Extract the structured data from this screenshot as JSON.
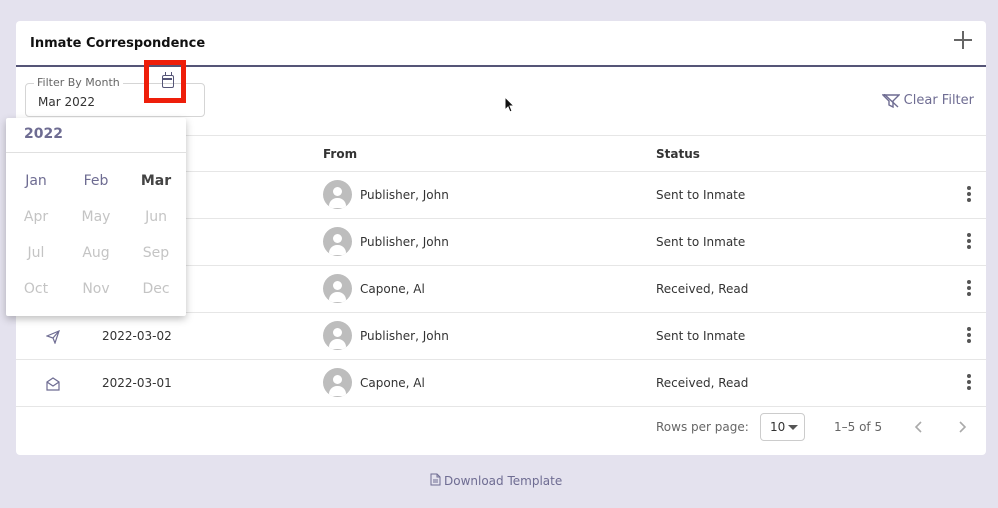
{
  "card": {
    "title": "Inmate Correspondence",
    "add_icon": "plus-icon"
  },
  "filter": {
    "label": "Filter By Month",
    "value": "Mar 2022",
    "calendar_icon": "calendar-icon"
  },
  "clear_filter": {
    "label": "Clear Filter",
    "icon": "filter-off-icon"
  },
  "table": {
    "headers": {
      "from": "From",
      "status": "Status"
    },
    "rows": [
      {
        "icon": "send-icon",
        "date": "",
        "from": "Publisher, John",
        "status": "Sent to Inmate"
      },
      {
        "icon": "send-icon",
        "date": "",
        "from": "Publisher, John",
        "status": "Sent to Inmate"
      },
      {
        "icon": "mail-open-icon",
        "date": "",
        "from": "Capone, Al",
        "status": "Received, Read"
      },
      {
        "icon": "send-icon",
        "date": "2022-03-02",
        "from": "Publisher, John",
        "status": "Sent to Inmate"
      },
      {
        "icon": "mail-open-icon",
        "date": "2022-03-01",
        "from": "Capone, Al",
        "status": "Received, Read"
      }
    ]
  },
  "pagination": {
    "rows_per_page_label": "Rows per page:",
    "rows_per_page": "10",
    "range": "1–5 of 5"
  },
  "download": {
    "label": "Download Template",
    "icon": "file-icon"
  },
  "month_picker": {
    "year": "2022",
    "months": [
      {
        "label": "Jan",
        "state": "enabled"
      },
      {
        "label": "Feb",
        "state": "enabled"
      },
      {
        "label": "Mar",
        "state": "selected"
      },
      {
        "label": "Apr",
        "state": "disabled"
      },
      {
        "label": "May",
        "state": "disabled"
      },
      {
        "label": "Jun",
        "state": "disabled"
      },
      {
        "label": "Jul",
        "state": "disabled"
      },
      {
        "label": "Aug",
        "state": "disabled"
      },
      {
        "label": "Sep",
        "state": "disabled"
      },
      {
        "label": "Oct",
        "state": "disabled"
      },
      {
        "label": "Nov",
        "state": "disabled"
      },
      {
        "label": "Dec",
        "state": "disabled"
      }
    ]
  },
  "colors": {
    "accent": "#6e6c92",
    "highlight": "#ee1e0a",
    "background": "#e4e2ee"
  }
}
